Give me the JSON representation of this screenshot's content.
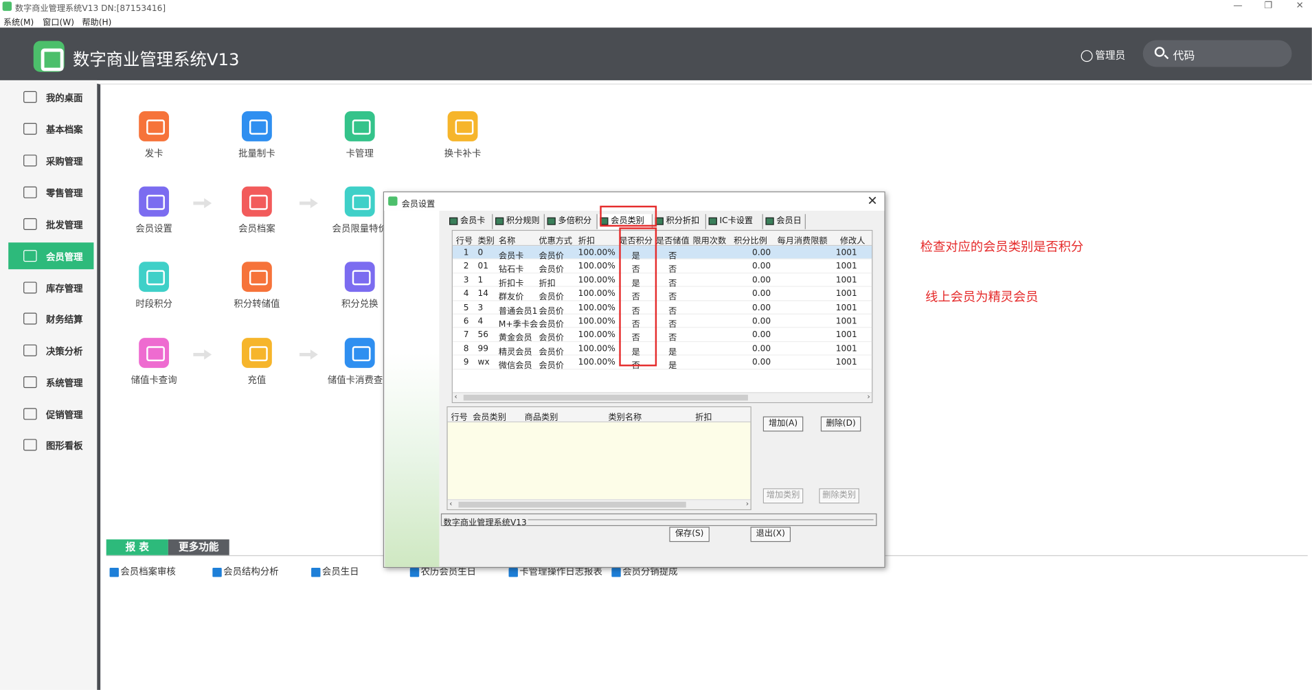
{
  "window": {
    "title": "数字商业管理系统V13 DN:[87153416]"
  },
  "menubar": {
    "items": [
      "系统(M)",
      "窗口(W)",
      "帮助(H)"
    ]
  },
  "header": {
    "app_title": "数字商业管理系统V13",
    "user_label": "管理员",
    "search_placeholder": "代码"
  },
  "sidebar": {
    "items": [
      {
        "label": "我的桌面",
        "icon": "desktop-icon"
      },
      {
        "label": "基本档案",
        "icon": "folder-icon"
      },
      {
        "label": "采购管理",
        "icon": "cart-icon"
      },
      {
        "label": "零售管理",
        "icon": "basket-icon"
      },
      {
        "label": "批发管理",
        "icon": "list-icon"
      },
      {
        "label": "会员管理",
        "icon": "crown-icon",
        "active": true
      },
      {
        "label": "库存管理",
        "icon": "warehouse-icon"
      },
      {
        "label": "财务结算",
        "icon": "finance-icon"
      },
      {
        "label": "决策分析",
        "icon": "chart-icon"
      },
      {
        "label": "系统管理",
        "icon": "gear-icon"
      },
      {
        "label": "促销管理",
        "icon": "promo-icon"
      },
      {
        "label": "图形看板",
        "icon": "monitor-icon"
      }
    ]
  },
  "tiles": [
    {
      "label": "发卡",
      "color": "#f6733a"
    },
    {
      "label": "批量制卡",
      "color": "#2f8ff0"
    },
    {
      "label": "卡管理",
      "color": "#34c38a"
    },
    {
      "label": "换卡补卡",
      "color": "#f6b52b"
    },
    {
      "label": "会员设置",
      "color": "#7b6cf0"
    },
    {
      "label": "会员档案",
      "color": "#f25b5b"
    },
    {
      "label": "会员限量特价",
      "color": "#3fd0c8"
    },
    {
      "label": "时段积分",
      "color": "#3fd0c8"
    },
    {
      "label": "积分转储值",
      "color": "#f6733a"
    },
    {
      "label": "积分兑换",
      "color": "#7b6cf0"
    },
    {
      "label": "储值卡查询",
      "color": "#ee6bd0"
    },
    {
      "label": "充值",
      "color": "#f6b52b"
    },
    {
      "label": "储值卡消费查询",
      "color": "#2f8ff0"
    }
  ],
  "report_tabs": {
    "active": "报  表",
    "other": "更多功能"
  },
  "report_links": [
    "会员档案审核",
    "会员结构分析",
    "会员生日",
    "农历会员生日",
    "卡管理操作日志报表",
    "会员分销提成"
  ],
  "dialog": {
    "title": "会员设置",
    "tabs": [
      "会员卡",
      "积分规则",
      "多倍积分",
      "会员类别",
      "积分折扣",
      "IC卡设置",
      "会员日"
    ],
    "grid_headers": [
      "行号",
      "类别",
      "名称",
      "优惠方式",
      "折扣",
      "是否积分",
      "是否储值",
      "限用次数",
      "积分比例",
      "每月消费限额",
      "修改人"
    ],
    "rows": [
      [
        "1",
        "0",
        "会员卡",
        "会员价",
        "100.00%",
        "是",
        "否",
        "",
        "0.00",
        "",
        "1001"
      ],
      [
        "2",
        "01",
        "钻石卡",
        "会员价",
        "100.00%",
        "否",
        "否",
        "",
        "0.00",
        "",
        "1001"
      ],
      [
        "3",
        "1",
        "折扣卡",
        "折扣",
        "100.00%",
        "是",
        "否",
        "",
        "0.00",
        "",
        "1001"
      ],
      [
        "4",
        "14",
        "群友价",
        "会员价",
        "100.00%",
        "否",
        "否",
        "",
        "0.00",
        "",
        "1001"
      ],
      [
        "5",
        "3",
        "普通会员1",
        "会员价",
        "100.00%",
        "否",
        "否",
        "",
        "0.00",
        "",
        "1001"
      ],
      [
        "6",
        "4",
        "M+季卡会员",
        "会员价",
        "100.00%",
        "否",
        "否",
        "",
        "0.00",
        "",
        "1001"
      ],
      [
        "7",
        "56",
        "黄金会员",
        "会员价",
        "100.00%",
        "否",
        "否",
        "",
        "0.00",
        "",
        "1001"
      ],
      [
        "8",
        "99",
        "精灵会员",
        "会员价",
        "100.00%",
        "是",
        "是",
        "",
        "0.00",
        "",
        "1001"
      ],
      [
        "9",
        "wx",
        "微信会员",
        "会员价",
        "100.00%",
        "否",
        "是",
        "",
        "0.00",
        "",
        "1001"
      ]
    ],
    "sub_headers": [
      "行号",
      "会员类别",
      "商品类别",
      "类别名称",
      "折扣"
    ],
    "buttons": {
      "add": "增加(A)",
      "delete": "删除(D)",
      "add_cat": "增加类别",
      "del_cat": "删除类别",
      "save": "保存(S)",
      "exit": "退出(X)"
    },
    "status": "数字商业管理系统V13"
  },
  "annotations": {
    "note1": "检查对应的会员类别是否积分",
    "note2": "线上会员为精灵会员",
    "color": "#e52b2b"
  }
}
